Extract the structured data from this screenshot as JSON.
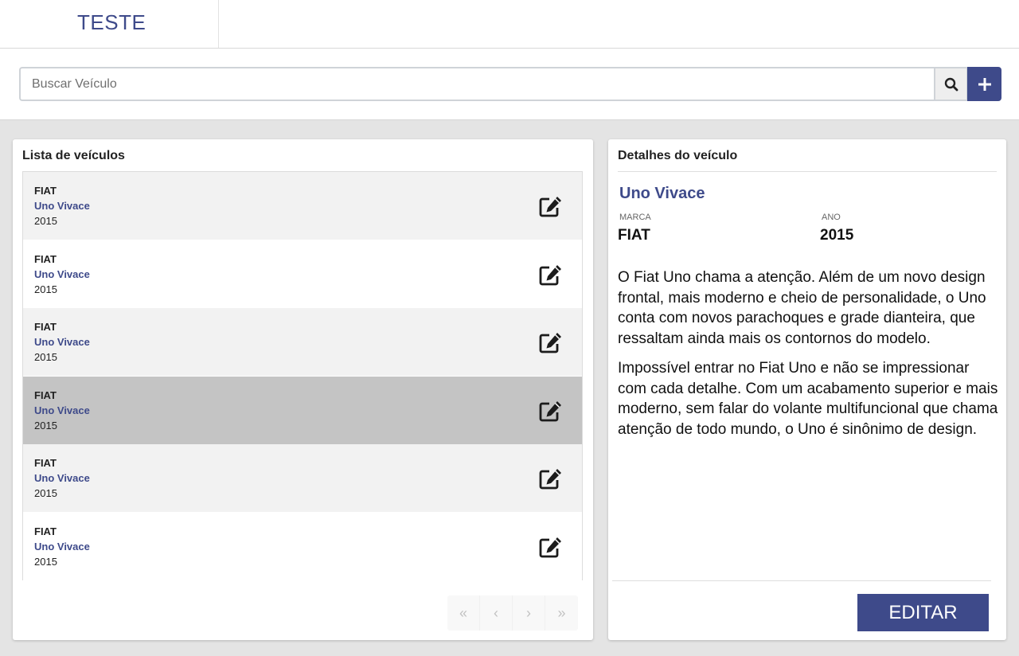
{
  "header": {
    "brand": "TESTE"
  },
  "search": {
    "placeholder": "Buscar Veículo"
  },
  "list": {
    "title": "Lista de veículos",
    "items": [
      {
        "brand": "FIAT",
        "model": "Uno Vivace",
        "year": "2015",
        "selected": false
      },
      {
        "brand": "FIAT",
        "model": "Uno Vivace",
        "year": "2015",
        "selected": false
      },
      {
        "brand": "FIAT",
        "model": "Uno Vivace",
        "year": "2015",
        "selected": false
      },
      {
        "brand": "FIAT",
        "model": "Uno Vivace",
        "year": "2015",
        "selected": true
      },
      {
        "brand": "FIAT",
        "model": "Uno Vivace",
        "year": "2015",
        "selected": false
      },
      {
        "brand": "FIAT",
        "model": "Uno Vivace",
        "year": "2015",
        "selected": false
      }
    ],
    "pagination": {
      "first": "«",
      "prev": "‹",
      "next": "›",
      "last": "»"
    }
  },
  "detail": {
    "title": "Detalhes do veículo",
    "model": "Uno Vivace",
    "brand_label": "MARCA",
    "brand_value": "FIAT",
    "year_label": "ANO",
    "year_value": "2015",
    "description": [
      "O Fiat Uno chama a atenção. Além de um novo design frontal, mais moderno e cheio de personalidade, o Uno conta com novos parachoques e grade dianteira, que ressaltam ainda mais os contornos do modelo.",
      "Impossível entrar no Fiat Uno e não se impressionar com cada detalhe. Com um acabamento superior e mais moderno, sem falar do volante multifuncional que chama atenção de todo mundo, o Uno é sinônimo de design."
    ],
    "edit_label": "EDITAR"
  },
  "colors": {
    "accent": "#3e4a8a",
    "row_odd": "#f2f2f2",
    "row_even": "#ffffff",
    "row_selected": "#c4c4c4"
  },
  "icons": {
    "search": "search-icon",
    "add": "plus-icon",
    "edit": "edit-icon"
  }
}
